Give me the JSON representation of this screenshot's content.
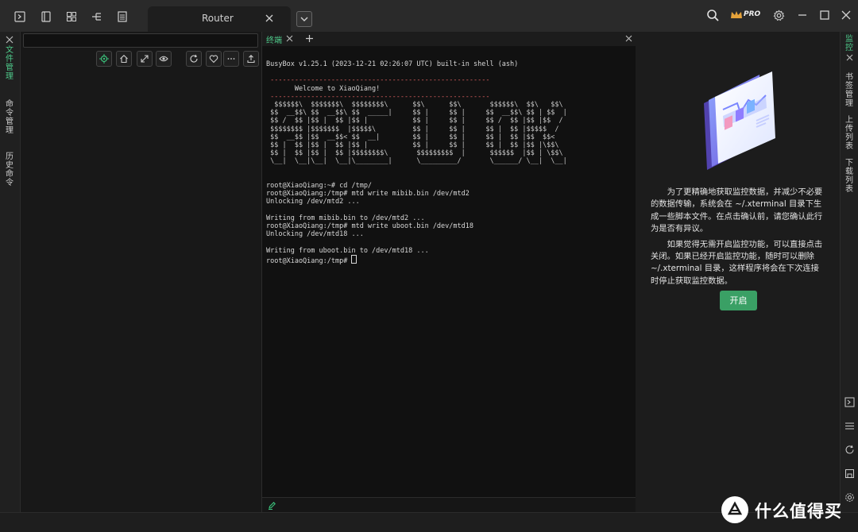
{
  "topbar": {
    "tab_title": "Router",
    "pro_badge": "PRO"
  },
  "left_sidebar": {
    "items": [
      "文件管理",
      "命令管理",
      "历史命令"
    ]
  },
  "terminal": {
    "tab_label": "终端",
    "lines": [
      "BusyBox v1.25.1 (2023-12-21 02:26:07 UTC) built-in shell (ash)",
      " ------------------------------------------------------",
      "       Welcome to XiaoQiang!",
      " ------------------------------------------------------",
      "  $$$$$$\\  $$$$$$$\\  $$$$$$$$\\      $$\\      $$\\       $$$$$$\\  $$\\   $$\\",
      " $$  __$$\\ $$  __$$\\ $$  _____|     $$ |     $$ |     $$  __$$\\ $$ | $$  |",
      " $$ /  $$ |$$ |  $$ |$$ |           $$ |     $$ |     $$ /  $$ |$$ |$$  /",
      " $$$$$$$$ |$$$$$$$  |$$$$$\\         $$ |     $$ |     $$ |  $$ |$$$$$  /",
      " $$  __$$ |$$  __$$< $$  __|        $$ |     $$ |     $$ |  $$ |$$  $$<",
      " $$ |  $$ |$$ |  $$ |$$ |           $$ |     $$ |     $$ |  $$ |$$ |\\$$\\",
      " $$ |  $$ |$$ |  $$ |$$$$$$$$\\       $$$$$$$$$  |      $$$$$$  |$$ | \\$$\\",
      " \\__|  \\__|\\__|  \\__|\\________|      \\_________/       \\______/ \\__|  \\__|",
      "root@XiaoQiang:~# cd /tmp/",
      "root@XiaoQiang:/tmp# mtd write mibib.bin /dev/mtd2",
      "Unlocking /dev/mtd2 ...",
      "Writing from mibib.bin to /dev/mtd2 ...",
      "root@XiaoQiang:/tmp# mtd write uboot.bin /dev/mtd18",
      "Unlocking /dev/mtd18 ...",
      "Writing from uboot.bin to /dev/mtd18 ...",
      "root@XiaoQiang:/tmp# "
    ]
  },
  "monitor": {
    "paragraph1": "为了更精确地获取监控数据，并减少不必要的数据传输，系统会在 ~/.xterminal 目录下生成一些脚本文件。在点击确认前，请您确认此行为是否有异议。",
    "paragraph2": "如果觉得无需开启监控功能，可以直接点击关闭。如果已经开启监控功能，随时可以删除 ~/.xterminal 目录，这样程序将会在下次连接时停止获取监控数据。",
    "button_label": "开启"
  },
  "right_sidebar": {
    "items": [
      "监控",
      "书签管理",
      "上传列表",
      "下载列表"
    ]
  },
  "watermark": {
    "text": "什么值得买"
  },
  "colors": {
    "accent_green": "#3aa065",
    "terminal_bg": "#111111",
    "app_bg": "#1b1b1b"
  },
  "icons": [
    "terminal-icon",
    "book-icon",
    "grid-icon",
    "tree-icon",
    "list-icon",
    "search-icon",
    "settings-icon",
    "minimize-icon",
    "maximize-icon",
    "close-icon",
    "locate-icon",
    "home-icon",
    "collapse-icon",
    "eye-icon",
    "refresh-icon",
    "heart-icon",
    "more-icon",
    "upload-icon",
    "add-tab-icon",
    "edit-icon"
  ]
}
